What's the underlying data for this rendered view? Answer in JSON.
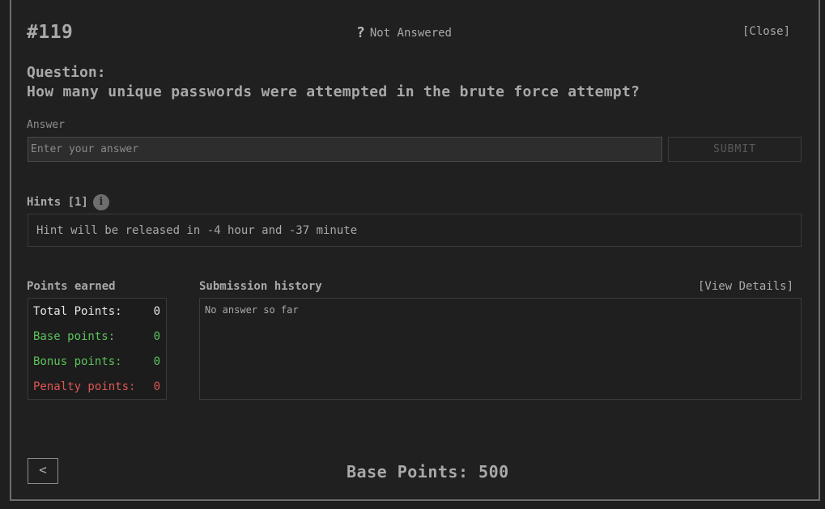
{
  "header": {
    "question_id": "#119",
    "status_icon": "question-mark-icon",
    "status_text": "Not Answered",
    "close_label": "[Close]"
  },
  "question": {
    "label": "Question:",
    "text": "How many unique passwords were attempted in the brute force attempt?"
  },
  "answer": {
    "label": "Answer",
    "placeholder": "Enter your answer",
    "value": "",
    "submit_label": "SUBMIT"
  },
  "hints": {
    "title": "Hints [1]",
    "info_icon": "info-icon",
    "text": "Hint will be released in -4 hour and -37 minute"
  },
  "points_earned": {
    "title": "Points earned",
    "rows": [
      {
        "label": "Total Points:",
        "value": "0"
      },
      {
        "label": "Base points:",
        "value": "0"
      },
      {
        "label": "Bonus points:",
        "value": "0"
      },
      {
        "label": "Penalty points:",
        "value": "0"
      }
    ]
  },
  "submission_history": {
    "title": "Submission history",
    "view_details_label": "[View Details]",
    "empty_text": "No answer so far"
  },
  "footer": {
    "back_icon": "chevron-left-icon",
    "base_points": "Base Points: 500"
  },
  "colors": {
    "background": "#1f1f1f",
    "text": "#a9a9a9",
    "positive": "#5cc25c",
    "negative": "#e05555"
  }
}
